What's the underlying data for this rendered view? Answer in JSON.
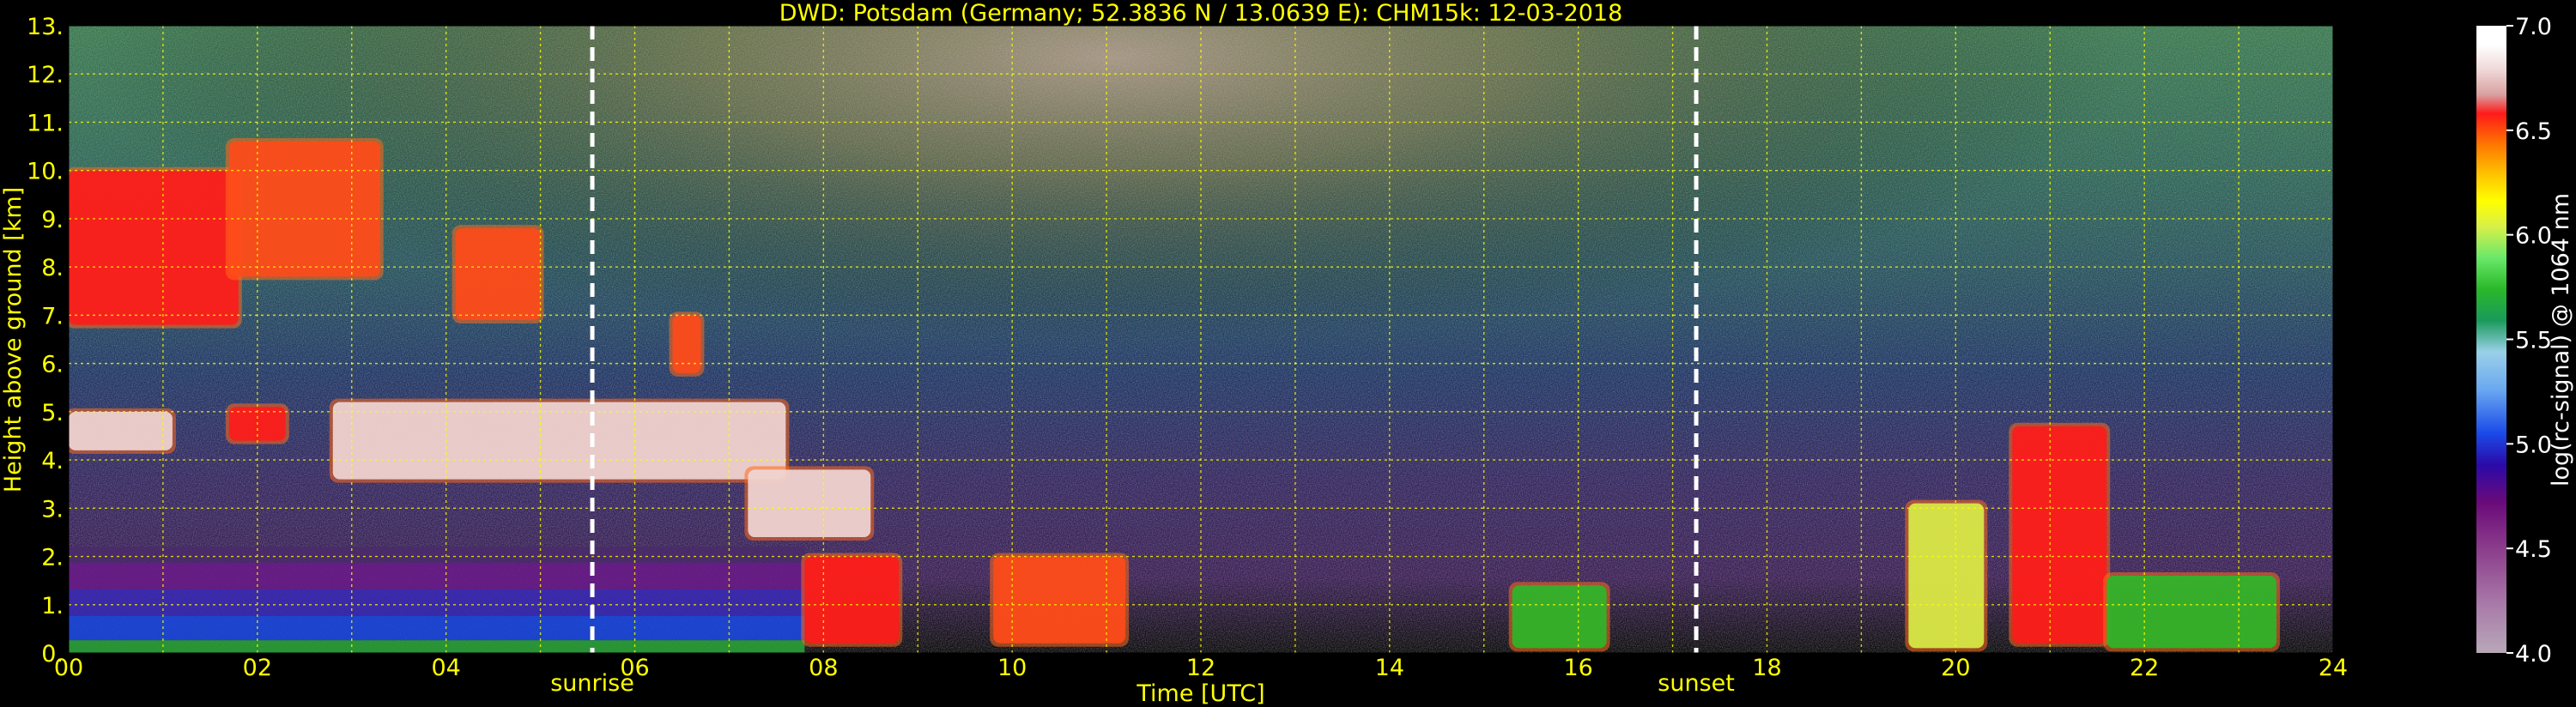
{
  "chart_data": {
    "type": "heatmap",
    "title": "DWD: Potsdam (Germany; 52.3836 N / 13.0639 E):    CHM15k: 12-03-2018",
    "xlabel": "Time [UTC]",
    "ylabel": "Height above ground [km]",
    "xlim": [
      0,
      24
    ],
    "ylim": [
      0,
      13
    ],
    "x_ticks": [
      "00",
      "02",
      "04",
      "06",
      "08",
      "10",
      "12",
      "14",
      "16",
      "18",
      "20",
      "22",
      "24"
    ],
    "y_ticks": [
      "0.",
      "1.",
      "2.",
      "3.",
      "4.",
      "5.",
      "6.",
      "7.",
      "8.",
      "9.",
      "10.",
      "11.",
      "12.",
      "13."
    ],
    "grid": true,
    "colorbar": {
      "label": "log(rc-signal) @ 1064 nm",
      "range": [
        4.0,
        7.0
      ],
      "ticks": [
        "4.0",
        "4.5",
        "5.0",
        "5.5",
        "6.0",
        "6.5",
        "7.0"
      ]
    },
    "annotations": [
      {
        "text": "sunrise",
        "x": 5.55
      },
      {
        "text": "sunset",
        "x": 17.25
      }
    ],
    "features": [
      {
        "kind": "cirrus",
        "x": [
          0.0,
          1.8
        ],
        "y": [
          6.8,
          10.0
        ],
        "level": 6.6
      },
      {
        "kind": "cirrus",
        "x": [
          1.7,
          3.3
        ],
        "y": [
          7.8,
          10.6
        ],
        "level": 6.3
      },
      {
        "kind": "cirrus",
        "x": [
          4.1,
          5.0
        ],
        "y": [
          6.9,
          8.8
        ],
        "level": 6.4
      },
      {
        "kind": "cirrus",
        "x": [
          6.4,
          6.7
        ],
        "y": [
          5.8,
          7.0
        ],
        "level": 6.3
      },
      {
        "kind": "cloud",
        "x": [
          0.0,
          1.1
        ],
        "y": [
          4.2,
          5.0
        ],
        "level": 6.7
      },
      {
        "kind": "cloud",
        "x": [
          1.7,
          2.3
        ],
        "y": [
          4.4,
          5.1
        ],
        "level": 6.6
      },
      {
        "kind": "cloud",
        "x": [
          2.8,
          7.6
        ],
        "y": [
          3.6,
          5.2
        ],
        "level": 6.9
      },
      {
        "kind": "cloud",
        "x": [
          7.2,
          8.5
        ],
        "y": [
          2.4,
          3.8
        ],
        "level": 6.8
      },
      {
        "kind": "boundary-layer",
        "x": [
          0.0,
          7.8
        ],
        "y": [
          0.0,
          2.2
        ],
        "level": 5.0
      },
      {
        "kind": "low-cloud",
        "x": [
          7.8,
          8.8
        ],
        "y": [
          0.2,
          2.0
        ],
        "level": 6.5
      },
      {
        "kind": "low-cloud",
        "x": [
          9.8,
          11.2
        ],
        "y": [
          0.2,
          2.0
        ],
        "level": 6.4
      },
      {
        "kind": "convective",
        "x": [
          15.3,
          16.3
        ],
        "y": [
          0.1,
          1.4
        ],
        "level": 5.8
      },
      {
        "kind": "convective",
        "x": [
          19.5,
          20.3
        ],
        "y": [
          0.1,
          3.1
        ],
        "level": 5.9
      },
      {
        "kind": "convective",
        "x": [
          20.6,
          21.6
        ],
        "y": [
          0.2,
          4.7
        ],
        "level": 6.6
      },
      {
        "kind": "convective",
        "x": [
          21.6,
          23.4
        ],
        "y": [
          0.1,
          1.6
        ],
        "level": 5.7
      }
    ]
  }
}
